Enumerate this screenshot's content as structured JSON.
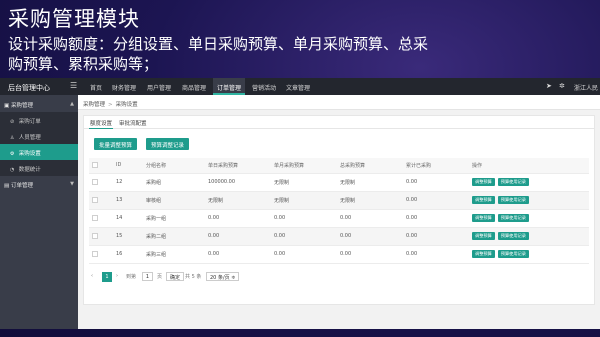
{
  "slide": {
    "title": "采购管理模块",
    "description": "设计采购额度：分组设置、单日采购预算、单月采购预算、总采购预算、累积采购等；"
  },
  "topbar": {
    "brand": "后台管理中心",
    "menu_icon": "menu-icon",
    "nav": [
      "首页",
      "财务管理",
      "用户管理",
      "商品管理",
      "订单管理",
      "营销活动",
      "文章管理"
    ],
    "active_nav": "订单管理",
    "right_icons": [
      "send-icon",
      "gear-icon"
    ],
    "user": "浙江人民"
  },
  "sidebar": {
    "group1": "采购管理",
    "items": [
      "采购订单",
      "人员管理",
      "采购设置",
      "数据统计"
    ],
    "active_item": "采购设置",
    "group2": "订单管理"
  },
  "breadcrumb": [
    "采购管理",
    "采购设置"
  ],
  "tabs": [
    "额度设置",
    "审批流配置"
  ],
  "buttons": {
    "batch_adjust": "批量调整预算",
    "adjust_log": "预算调整记录"
  },
  "table": {
    "columns": [
      "ID",
      "分组名称",
      "单日采购预算",
      "单月采购预算",
      "总采购预算",
      "累计已采购",
      "操作"
    ],
    "rows": [
      [
        "12",
        "采购组",
        "100000.00",
        "无限制",
        "无限制",
        "0.00"
      ],
      [
        "13",
        "审核组",
        "无限制",
        "无限制",
        "无限制",
        "0.00"
      ],
      [
        "14",
        "采购一组",
        "0.00",
        "0.00",
        "0.00",
        "0.00"
      ],
      [
        "15",
        "采购二组",
        "0.00",
        "0.00",
        "0.00",
        "0.00"
      ],
      [
        "16",
        "采购三组",
        "0.00",
        "0.00",
        "0.00",
        "0.00"
      ]
    ],
    "actions": [
      "调整预算",
      "预算使用记录"
    ]
  },
  "pagination": {
    "prev": "‹",
    "current_page": "1",
    "next": "›",
    "goto_prefix": "到第",
    "goto_value": "1",
    "goto_suffix": "页",
    "confirm": "确定",
    "total": "共 5 条",
    "page_size": "20 条/页 ≑"
  },
  "colors": {
    "accent": "#1e9c8c",
    "topbar": "#23262e",
    "sidebar": "#393d49",
    "slide_bg": "#1c1552"
  }
}
